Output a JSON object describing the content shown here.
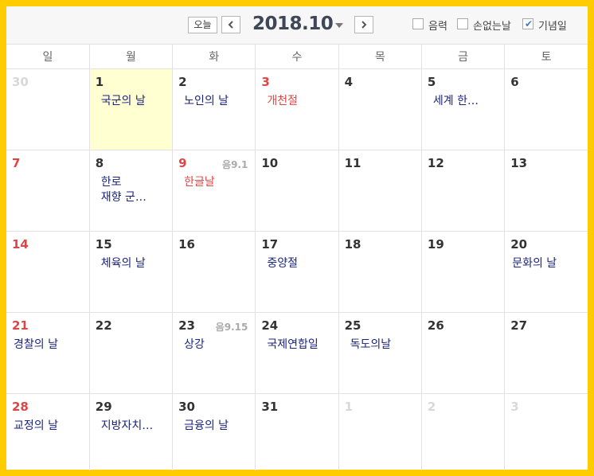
{
  "toolbar": {
    "today_label": "오늘",
    "title": "2018.10",
    "options": [
      {
        "label": "음력",
        "checked": false
      },
      {
        "label": "손없는날",
        "checked": false
      },
      {
        "label": "기념일",
        "checked": true
      }
    ]
  },
  "weekdays": [
    "일",
    "월",
    "화",
    "수",
    "목",
    "금",
    "토"
  ],
  "weeks": [
    [
      {
        "day": "30",
        "style": "other",
        "event": ""
      },
      {
        "day": "1",
        "style": "",
        "event": "국군의 날",
        "today": true
      },
      {
        "day": "2",
        "style": "",
        "event": "노인의 날"
      },
      {
        "day": "3",
        "style": "holiday",
        "event": "개천절",
        "event_style": "red"
      },
      {
        "day": "4",
        "style": "",
        "event": ""
      },
      {
        "day": "5",
        "style": "",
        "event": "세계 한…"
      },
      {
        "day": "6",
        "style": "",
        "event": ""
      }
    ],
    [
      {
        "day": "7",
        "style": "sun",
        "event": ""
      },
      {
        "day": "8",
        "style": "",
        "event": "한로\n재향 군…"
      },
      {
        "day": "9",
        "style": "holiday",
        "event": "한글날",
        "event_style": "red",
        "lunar": "음9.1"
      },
      {
        "day": "10",
        "style": "",
        "event": ""
      },
      {
        "day": "11",
        "style": "",
        "event": ""
      },
      {
        "day": "12",
        "style": "",
        "event": ""
      },
      {
        "day": "13",
        "style": "",
        "event": ""
      }
    ],
    [
      {
        "day": "14",
        "style": "sun",
        "event": ""
      },
      {
        "day": "15",
        "style": "",
        "event": "체육의 날"
      },
      {
        "day": "16",
        "style": "",
        "event": ""
      },
      {
        "day": "17",
        "style": "",
        "event": "중양절"
      },
      {
        "day": "18",
        "style": "",
        "event": ""
      },
      {
        "day": "19",
        "style": "",
        "event": ""
      },
      {
        "day": "20",
        "style": "",
        "event": "문화의 날",
        "wide": true
      }
    ],
    [
      {
        "day": "21",
        "style": "sun",
        "event": "경찰의 날",
        "wide": true
      },
      {
        "day": "22",
        "style": "",
        "event": ""
      },
      {
        "day": "23",
        "style": "",
        "event": "상강",
        "lunar": "음9.15"
      },
      {
        "day": "24",
        "style": "",
        "event": "국제연합일"
      },
      {
        "day": "25",
        "style": "",
        "event": "독도의날"
      },
      {
        "day": "26",
        "style": "",
        "event": ""
      },
      {
        "day": "27",
        "style": "",
        "event": ""
      }
    ],
    [
      {
        "day": "28",
        "style": "sun",
        "event": "교정의 날",
        "wide": true
      },
      {
        "day": "29",
        "style": "",
        "event": "지방자치…"
      },
      {
        "day": "30",
        "style": "",
        "event": "금융의 날"
      },
      {
        "day": "31",
        "style": "",
        "event": ""
      },
      {
        "day": "1",
        "style": "other",
        "event": ""
      },
      {
        "day": "2",
        "style": "other",
        "event": ""
      },
      {
        "day": "3",
        "style": "other",
        "event": ""
      }
    ]
  ]
}
